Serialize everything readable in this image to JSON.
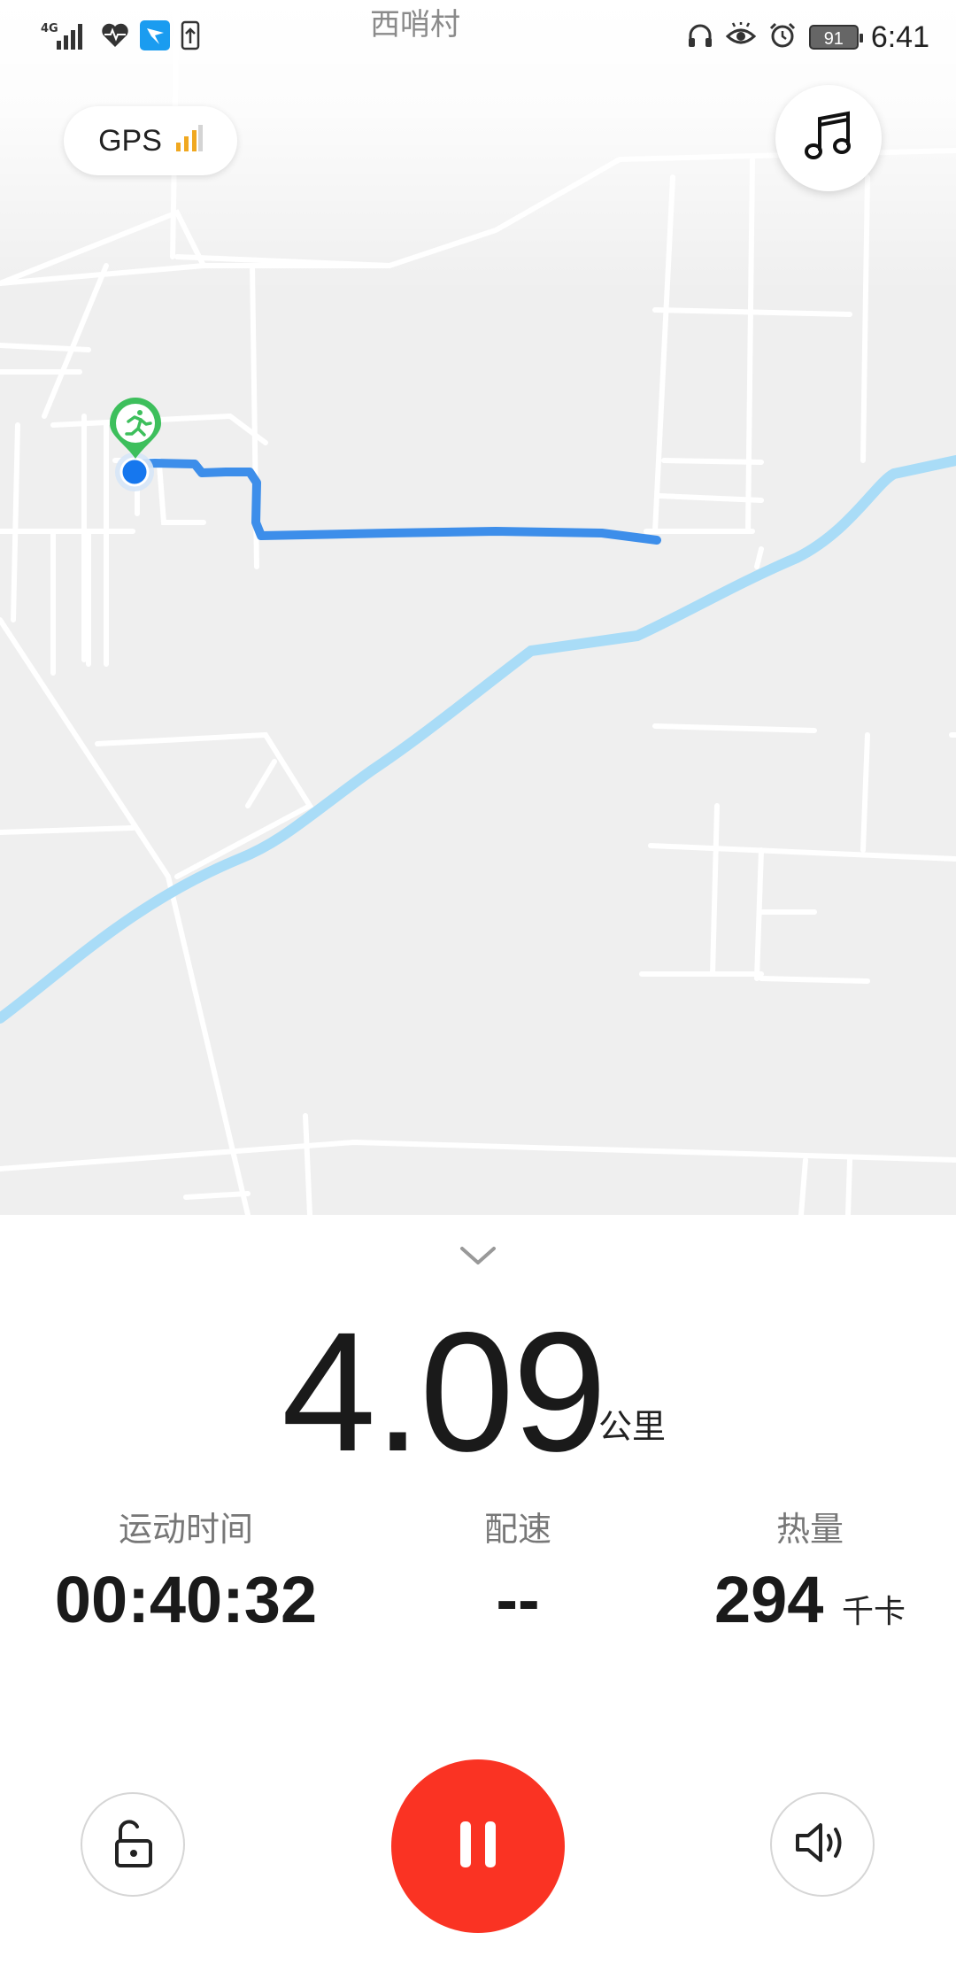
{
  "status_bar": {
    "network_label": "4G",
    "time": "6:41",
    "battery": "91",
    "icons": [
      "signal-icon",
      "health-heart-icon",
      "app-notification-icon",
      "upload-icon",
      "headphones-icon",
      "eye-comfort-icon",
      "alarm-icon",
      "battery-icon"
    ]
  },
  "map": {
    "place_label": "西哨村",
    "gps_label": "GPS",
    "gps_signal_level": 0.75,
    "colors": {
      "background": "#efefef",
      "roads": "#ffffff",
      "river": "#a9dcf7",
      "route": "#3d8eea",
      "start_marker": "#3dbf5c",
      "current_position": "#1677ee"
    }
  },
  "workout": {
    "distance_value": "4.09",
    "distance_unit": "公里",
    "stats": [
      {
        "label": "运动时间",
        "value": "00:40:32",
        "unit": ""
      },
      {
        "label": "配速",
        "value": "--",
        "unit": ""
      },
      {
        "label": "热量",
        "value": "294",
        "unit": "千卡"
      }
    ]
  },
  "controls": {
    "accent_color": "#fa3323",
    "icons": [
      "music-icon",
      "chevron-down-icon",
      "unlock-icon",
      "pause-icon",
      "speaker-icon"
    ]
  }
}
